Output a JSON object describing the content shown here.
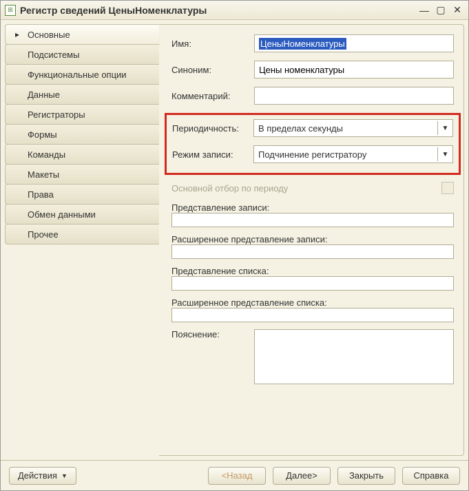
{
  "title": "Регистр сведений ЦеныНоменклатуры",
  "sidebar": {
    "items": [
      "Основные",
      "Подсистемы",
      "Функциональные опции",
      "Данные",
      "Регистраторы",
      "Формы",
      "Команды",
      "Макеты",
      "Права",
      "Обмен данными",
      "Прочее"
    ],
    "active_index": 0
  },
  "form": {
    "name_label": "Имя:",
    "name_value": "ЦеныНоменклатуры",
    "synonym_label": "Синоним:",
    "synonym_value": "Цены номенклатуры",
    "comment_label": "Комментарий:",
    "comment_value": "",
    "periodicity_label": "Периодичность:",
    "periodicity_value": "В пределах секунды",
    "write_mode_label": "Режим записи:",
    "write_mode_value": "Подчинение регистратору",
    "main_filter_label": "Основной отбор по периоду",
    "record_presentation_label": "Представление записи:",
    "record_presentation_value": "",
    "ext_record_presentation_label": "Расширенное представление записи:",
    "ext_record_presentation_value": "",
    "list_presentation_label": "Представление списка:",
    "list_presentation_value": "",
    "ext_list_presentation_label": "Расширенное представление списка:",
    "ext_list_presentation_value": "",
    "explanation_label": "Пояснение:",
    "explanation_value": ""
  },
  "footer": {
    "actions": "Действия",
    "back": "<Назад",
    "next": "Далее>",
    "close": "Закрыть",
    "help": "Справка"
  }
}
